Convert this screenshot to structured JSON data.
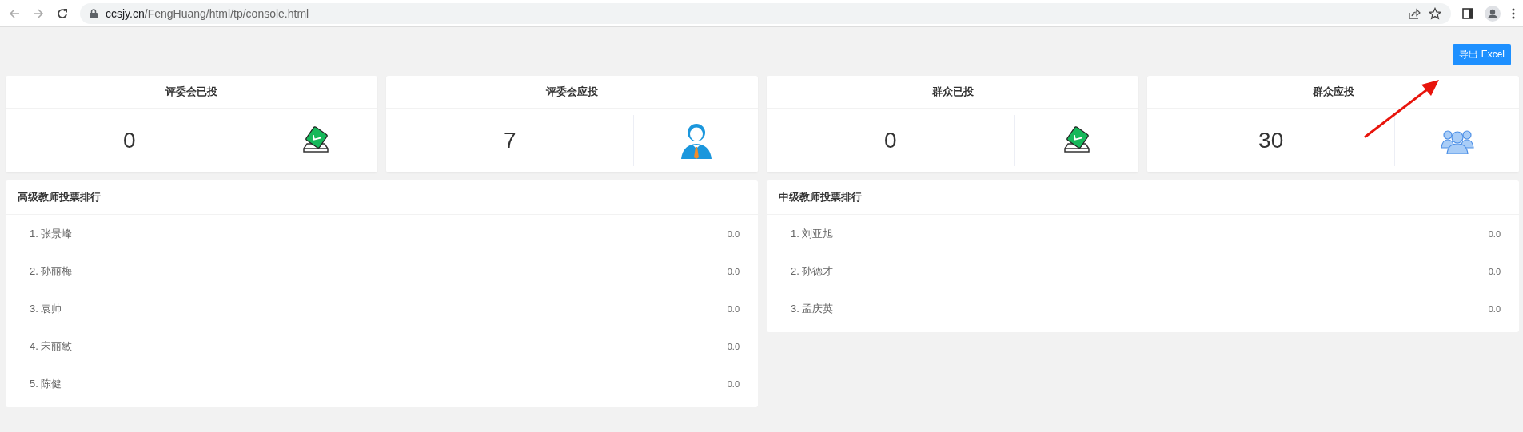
{
  "browser": {
    "url_host": "ccsjy.cn",
    "url_path": "/FengHuang/html/tp/console.html"
  },
  "export_button": "导出 Excel",
  "stat_cards": [
    {
      "title": "评委会已投",
      "value": "0",
      "kind": "ballot"
    },
    {
      "title": "评委会应投",
      "value": "7",
      "kind": "person"
    },
    {
      "title": "群众已投",
      "value": "0",
      "kind": "ballot"
    },
    {
      "title": "群众应投",
      "value": "30",
      "kind": "group"
    }
  ],
  "rankings": [
    {
      "title": "高级教师投票排行",
      "rows": [
        {
          "name": "1. 张景峰",
          "score": "0.0"
        },
        {
          "name": "2. 孙丽梅",
          "score": "0.0"
        },
        {
          "name": "3. 袁帅",
          "score": "0.0"
        },
        {
          "name": "4. 宋丽敏",
          "score": "0.0"
        },
        {
          "name": "5. 陈健",
          "score": "0.0"
        }
      ]
    },
    {
      "title": "中级教师投票排行",
      "rows": [
        {
          "name": "1. 刘亚旭",
          "score": "0.0"
        },
        {
          "name": "2. 孙德才",
          "score": "0.0"
        },
        {
          "name": "3. 孟庆英",
          "score": "0.0"
        }
      ]
    }
  ]
}
